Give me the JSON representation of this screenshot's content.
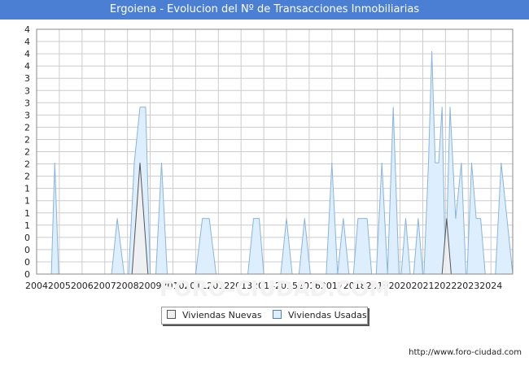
{
  "header": {
    "title": "Ergoiena - Evolucion del Nº de Transacciones Inmobiliarias"
  },
  "source_text": "http://www.foro-ciudad.com",
  "colors": {
    "usadas_fill": "#ddeeff",
    "usadas_stroke": "#8ab4dc",
    "nuevas_fill": "#f0f0f0",
    "nuevas_stroke": "#555555",
    "grid": "#cccccc"
  },
  "chart_data": {
    "type": "area",
    "title": "Ergoiena - Evolucion del Nº de Transacciones Inmobiliarias",
    "xlabel": "",
    "ylabel": "",
    "x_ticks": [
      "2004",
      "2005",
      "2006",
      "2007",
      "2008",
      "2009",
      "2010",
      "2011",
      "2012",
      "2013",
      "2014",
      "2015",
      "2016",
      "2017",
      "2018",
      "2019",
      "2020",
      "2021",
      "2022",
      "2023",
      "2024"
    ],
    "y_ticks": [
      "0",
      "0",
      "0",
      "0",
      "1",
      "1",
      "1",
      "1",
      "2",
      "2",
      "2",
      "2",
      "2",
      "3",
      "3",
      "3",
      "3",
      "4",
      "4",
      "4",
      "4"
    ],
    "xlim": [
      2004,
      2024.96
    ],
    "ylim": [
      0,
      4.4
    ],
    "grid": true,
    "legend": {
      "position": "bottom",
      "entries": [
        "Viviendas Nuevas",
        "Viviendas Usadas"
      ]
    },
    "series": [
      {
        "name": "Viviendas Nuevas",
        "points": [
          [
            2004.5,
            0
          ],
          [
            2008.2,
            0
          ],
          [
            2008.55,
            2
          ],
          [
            2008.9,
            0
          ],
          [
            2021.85,
            0
          ],
          [
            2022.05,
            1
          ],
          [
            2022.25,
            0
          ],
          [
            2024.96,
            0
          ]
        ]
      },
      {
        "name": "Viviendas Usadas",
        "points": [
          [
            2004.5,
            0
          ],
          [
            2004.65,
            0
          ],
          [
            2004.8,
            2
          ],
          [
            2004.97,
            0
          ],
          [
            2007.3,
            0
          ],
          [
            2007.55,
            1
          ],
          [
            2007.85,
            0
          ],
          [
            2008.05,
            0
          ],
          [
            2008.3,
            2
          ],
          [
            2008.55,
            3
          ],
          [
            2008.8,
            3
          ],
          [
            2009.0,
            0
          ],
          [
            2009.25,
            0
          ],
          [
            2009.5,
            2
          ],
          [
            2009.75,
            0
          ],
          [
            2011.0,
            0
          ],
          [
            2011.3,
            1
          ],
          [
            2011.6,
            1
          ],
          [
            2011.9,
            0
          ],
          [
            2013.3,
            0
          ],
          [
            2013.55,
            1
          ],
          [
            2013.8,
            1
          ],
          [
            2014.0,
            0
          ],
          [
            2014.75,
            0
          ],
          [
            2015.0,
            1
          ],
          [
            2015.25,
            0
          ],
          [
            2015.55,
            0
          ],
          [
            2015.8,
            1
          ],
          [
            2016.05,
            0
          ],
          [
            2016.75,
            0
          ],
          [
            2017.0,
            2
          ],
          [
            2017.25,
            0
          ],
          [
            2017.25,
            0
          ],
          [
            2017.5,
            1
          ],
          [
            2017.75,
            0
          ],
          [
            2017.95,
            0
          ],
          [
            2018.15,
            1
          ],
          [
            2018.55,
            1
          ],
          [
            2018.75,
            0
          ],
          [
            2018.95,
            0
          ],
          [
            2019.2,
            2
          ],
          [
            2019.45,
            0
          ],
          [
            2019.45,
            0
          ],
          [
            2019.7,
            3
          ],
          [
            2019.95,
            0
          ],
          [
            2020.05,
            0
          ],
          [
            2020.25,
            1
          ],
          [
            2020.45,
            0
          ],
          [
            2020.6,
            0
          ],
          [
            2020.8,
            1
          ],
          [
            2021.0,
            0
          ],
          [
            2021.05,
            0
          ],
          [
            2021.25,
            2
          ],
          [
            2021.4,
            4
          ],
          [
            2021.55,
            2
          ],
          [
            2021.7,
            2
          ],
          [
            2021.85,
            3
          ],
          [
            2022.0,
            0
          ],
          [
            2022.0,
            0
          ],
          [
            2022.2,
            3
          ],
          [
            2022.45,
            1
          ],
          [
            2022.7,
            2
          ],
          [
            2022.9,
            0
          ],
          [
            2022.95,
            0
          ],
          [
            2023.15,
            2
          ],
          [
            2023.35,
            1
          ],
          [
            2023.55,
            1
          ],
          [
            2023.75,
            0
          ],
          [
            2024.2,
            0
          ],
          [
            2024.45,
            2
          ],
          [
            2024.96,
            0
          ]
        ]
      }
    ]
  },
  "legend_labels": {
    "nuevas": "Viviendas Nuevas",
    "usadas": "Viviendas Usadas"
  }
}
